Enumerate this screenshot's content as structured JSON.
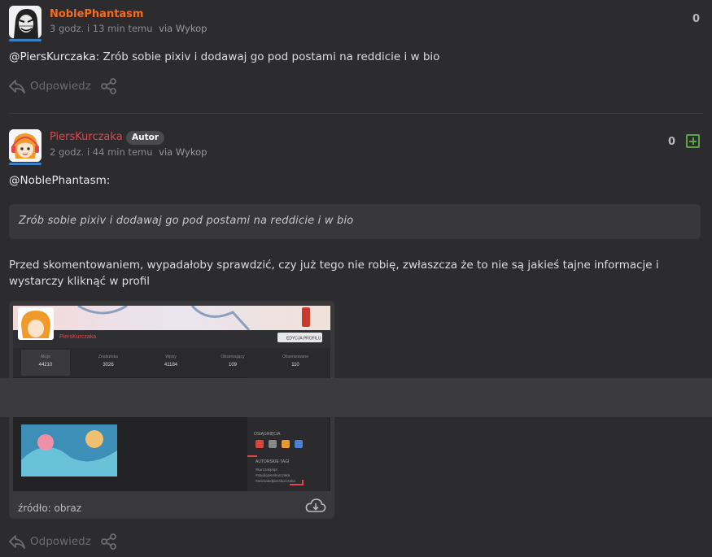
{
  "comments": [
    {
      "author": "NoblePhantasm",
      "time": "3 godz. i 13 min temu",
      "via": "via Wykop",
      "votes": "0",
      "mention": "@PiersKurczaka",
      "text": ": Zrób sobie pixiv i dodawaj go pod postami na reddicie i w bio",
      "reply_label": "Odpowiedz"
    },
    {
      "author": "PiersKurczaka",
      "badge": "Autor",
      "time": "2 godz. i 44 min temu",
      "via": "via Wykop",
      "votes": "0",
      "mention": "@NoblePhantasm:",
      "quote": "Zrób sobie pixiv i dodawaj go pod postami na reddicie i w bio",
      "text": "Przed skomentowaniem, wypadałoby sprawdzić, czy już tego nie robię, zwłaszcza że to nie są jakieś tajne informacje i wystarczy kliknąć w profil",
      "media_source": "źródło: obraz",
      "reply_label": "Odpowiedz"
    }
  ],
  "embedded_screenshot": {
    "profile_name": "PiersKurczaka",
    "edit_button": "EDYCJA PROFILU",
    "stats": [
      {
        "label": "Akcje",
        "value": "44210"
      },
      {
        "label": "Znaleziska",
        "value": "3026"
      },
      {
        "label": "Wpisy",
        "value": "41184"
      },
      {
        "label": "Obserwujący",
        "value": "109"
      },
      {
        "label": "Obserwowane",
        "value": "110"
      }
    ],
    "sections": [
      "OSIĄGNIĘCIA",
      "AUTORSKIE TAGI"
    ],
    "tags": [
      "#kurczakpopr",
      "#studiopierskurczaka",
      "#animatedpierskurczaka"
    ]
  },
  "colors": {
    "background": "#2c2c2e",
    "author_orange": "#f36c21",
    "author_red": "#e0474c",
    "plus_green": "#5aa644"
  }
}
